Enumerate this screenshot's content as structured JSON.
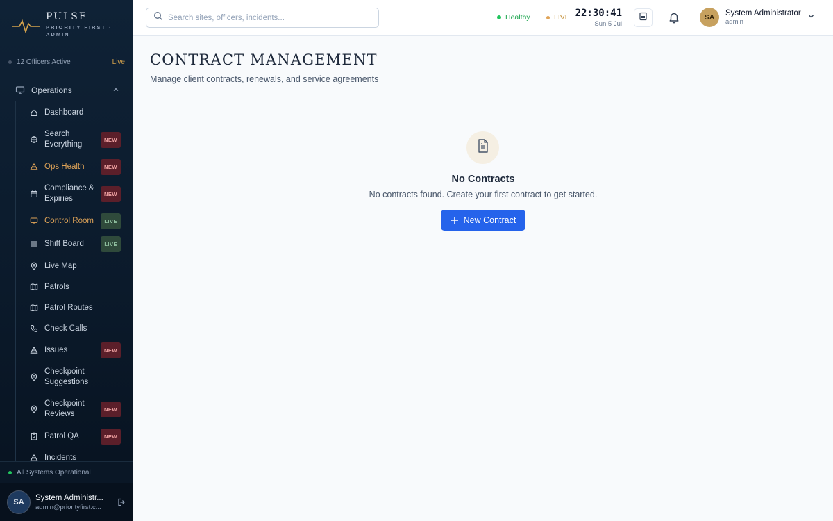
{
  "brand": {
    "name": "PULSE",
    "subtitle": "PRIORITY FIRST · ADMIN"
  },
  "sidebar": {
    "officers_active": "12 Officers Active",
    "live_label": "Live",
    "group": {
      "label": "Operations"
    },
    "items": [
      {
        "label": "Dashboard",
        "icon": "home-icon",
        "badge": ""
      },
      {
        "label": "Search Everything",
        "icon": "search-globe-icon",
        "badge": "NEW"
      },
      {
        "label": "Ops Health",
        "icon": "warning-icon",
        "badge": "NEW"
      },
      {
        "label": "Compliance & Expiries",
        "icon": "calendar-icon",
        "badge": "NEW"
      },
      {
        "label": "Control Room",
        "icon": "monitor-icon",
        "badge": "LIVE"
      },
      {
        "label": "Shift Board",
        "icon": "list-icon",
        "badge": "LIVE"
      },
      {
        "label": "Live Map",
        "icon": "map-pin-icon",
        "badge": ""
      },
      {
        "label": "Patrols",
        "icon": "map-icon",
        "badge": ""
      },
      {
        "label": "Patrol Routes",
        "icon": "map-icon",
        "badge": ""
      },
      {
        "label": "Check Calls",
        "icon": "phone-icon",
        "badge": ""
      },
      {
        "label": "Issues",
        "icon": "warning-icon",
        "badge": "NEW"
      },
      {
        "label": "Checkpoint Suggestions",
        "icon": "map-pin-icon",
        "badge": ""
      },
      {
        "label": "Checkpoint Reviews",
        "icon": "map-pin-icon",
        "badge": "NEW"
      },
      {
        "label": "Patrol QA",
        "icon": "clipboard-icon",
        "badge": "NEW"
      },
      {
        "label": "Incidents",
        "icon": "warning-icon",
        "badge": ""
      }
    ],
    "system_status": "All Systems Operational",
    "user": {
      "initials": "SA",
      "name": "System Administr...",
      "email": "admin@priorityfirst.c..."
    }
  },
  "topbar": {
    "search_placeholder": "Search sites, officers, incidents...",
    "health": "Healthy",
    "live": "LIVE",
    "time": "22:30:41",
    "date": "Sun 5 Jul",
    "user": {
      "initials": "SA",
      "name": "System Administrator",
      "role": "admin"
    }
  },
  "main": {
    "title": "CONTRACT MANAGEMENT",
    "subtitle": "Manage client contracts, renewals, and service agreements",
    "empty_title": "No Contracts",
    "empty_desc": "No contracts found. Create your first contract to get started.",
    "new_button": "New Contract"
  },
  "colors": {
    "accent": "#e0a458",
    "primary": "#2563eb",
    "sidebar_bg": "#0f2236",
    "healthy": "#22c55e"
  }
}
